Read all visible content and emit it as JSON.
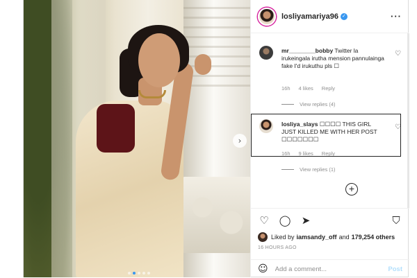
{
  "post": {
    "username": "losliyamariya96",
    "verified_icon": "verified-badge-icon",
    "more_icon": "more-dots-icon",
    "next_icon": "chevron-right-icon",
    "carousel": {
      "count": 5,
      "active": 2
    }
  },
  "comments": [
    {
      "user": "mr________bobby",
      "text": "Twitter la irukeingala irutha mension pannulainga fake I'd irukuthu pls ☐",
      "time": "16h",
      "likes": "4 likes",
      "reply": "Reply",
      "view_replies": "View replies (4)"
    },
    {
      "user": "losliya_slays",
      "text": "☐☐☐☐ THIS GIRL JUST KILLED ME WITH HER POST ☐☐☐☐☐☐☐",
      "time": "16h",
      "likes": "9 likes",
      "reply": "Reply",
      "view_replies": "View replies (1)"
    }
  ],
  "load_more": "+",
  "footer": {
    "liked_by_prefix": "Liked by",
    "liked_by_user": "iamsandy_off",
    "liked_by_and": "and",
    "liked_by_count": "179,254 others",
    "timestamp": "16 HOURS AGO",
    "comment_placeholder": "Add a comment...",
    "post_label": "Post",
    "icons": [
      "heart-icon",
      "comment-icon",
      "share-icon",
      "bookmark-icon",
      "emoji-icon"
    ]
  },
  "colors": {
    "accent": "#3897f0",
    "text": "#262626",
    "muted": "#8e8e8e",
    "post_disabled": "#b2dffc"
  }
}
